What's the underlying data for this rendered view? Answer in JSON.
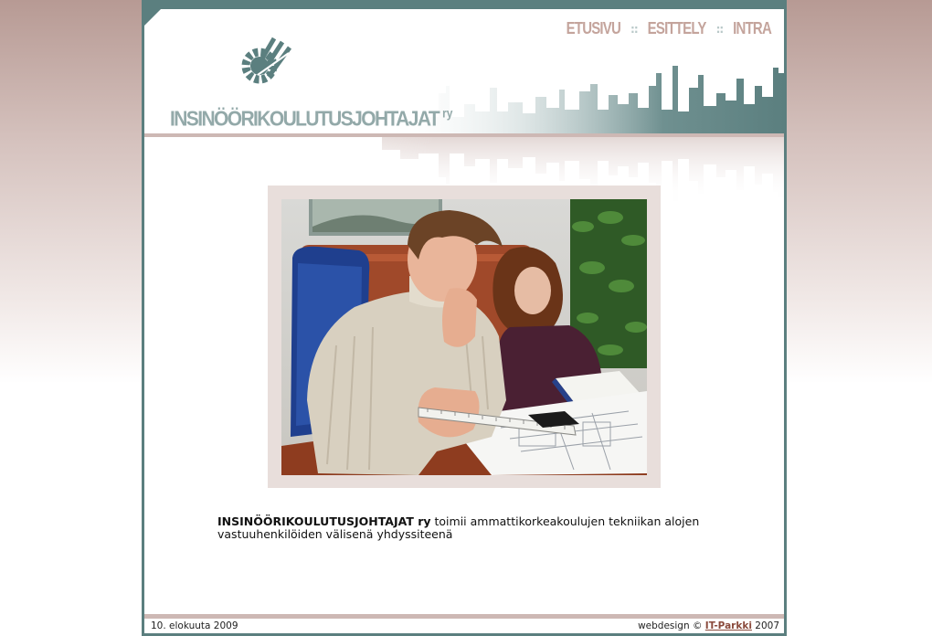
{
  "header": {
    "logo_text": "INSINÖÖRIKOULUTUSJOHTAJAT",
    "logo_suffix": "ry",
    "nav": [
      {
        "label": "ETUSIVU"
      },
      {
        "label": "ESITTELY"
      },
      {
        "label": "INTRA"
      }
    ],
    "nav_separator": "::"
  },
  "colors": {
    "teal": "#5b7f7f",
    "rose": "#cdb8b4",
    "nav_text": "#c4a49c",
    "logo_text": "#93a9a9"
  },
  "main": {
    "photo_icon": "office-photo",
    "intro_bold": "INSINÖÖRIKOULUTUSJOHTAJAT ry",
    "intro_text": " toimii ammattikorkeakoulujen tekniikan alojen vastuuhenkilöiden välisenä yhdyssiteenä"
  },
  "footer": {
    "date": "10. elokuuta 2009",
    "credit_prefix": "webdesign © ",
    "credit_link": "IT-Parkki",
    "credit_suffix": " 2007"
  }
}
